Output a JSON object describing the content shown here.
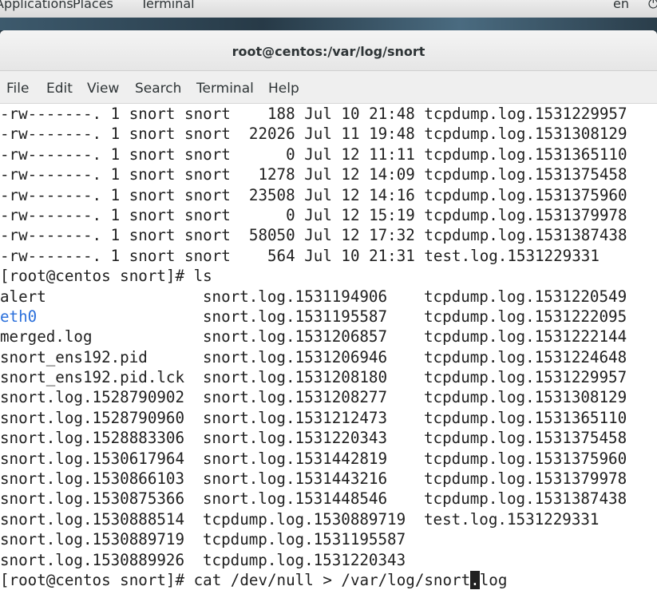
{
  "topbar": {
    "menu": [
      "Applications",
      "Places",
      "Terminal"
    ],
    "lang": "en",
    "power_icon": "power-icon"
  },
  "window": {
    "title": "root@centos:/var/log/snort"
  },
  "menubar": {
    "items": [
      "File",
      "Edit",
      "View",
      "Search",
      "Terminal",
      "Help"
    ]
  },
  "terminal": {
    "ls_long": [
      "-rw-------. 1 snort snort    188 Jul 10 21:48 tcpdump.log.1531229957",
      "-rw-------. 1 snort snort  22026 Jul 11 19:48 tcpdump.log.1531308129",
      "-rw-------. 1 snort snort      0 Jul 12 11:11 tcpdump.log.1531365110",
      "-rw-------. 1 snort snort   1278 Jul 12 14:09 tcpdump.log.1531375458",
      "-rw-------. 1 snort snort  23508 Jul 12 14:16 tcpdump.log.1531375960",
      "-rw-------. 1 snort snort      0 Jul 12 15:19 tcpdump.log.1531379978",
      "-rw-------. 1 snort snort  58050 Jul 12 17:32 tcpdump.log.1531387438",
      "-rw-------. 1 snort snort    564 Jul 10 21:31 test.log.1531229331"
    ],
    "prompt_ls": "[root@centos snort]# ls",
    "ls_rows": [
      [
        "alert",
        "snort.log.1531194906",
        "tcpdump.log.1531220549"
      ],
      [
        "eth0",
        "snort.log.1531195587",
        "tcpdump.log.1531222095"
      ],
      [
        "merged.log",
        "snort.log.1531206857",
        "tcpdump.log.1531222144"
      ],
      [
        "snort_ens192.pid",
        "snort.log.1531206946",
        "tcpdump.log.1531224648"
      ],
      [
        "snort_ens192.pid.lck",
        "snort.log.1531208180",
        "tcpdump.log.1531229957"
      ],
      [
        "snort.log.1528790902",
        "snort.log.1531208277",
        "tcpdump.log.1531308129"
      ],
      [
        "snort.log.1528790960",
        "snort.log.1531212473",
        "tcpdump.log.1531365110"
      ],
      [
        "snort.log.1528883306",
        "snort.log.1531220343",
        "tcpdump.log.1531375458"
      ],
      [
        "snort.log.1530617964",
        "snort.log.1531442819",
        "tcpdump.log.1531375960"
      ],
      [
        "snort.log.1530866103",
        "snort.log.1531443216",
        "tcpdump.log.1531379978"
      ],
      [
        "snort.log.1530875366",
        "snort.log.1531448546",
        "tcpdump.log.1531387438"
      ],
      [
        "snort.log.1530888514",
        "tcpdump.log.1530889719",
        "test.log.1531229331"
      ],
      [
        "snort.log.1530889719",
        "tcpdump.log.1531195587",
        ""
      ],
      [
        "snort.log.1530889926",
        "tcpdump.log.1531220343",
        ""
      ]
    ],
    "directory_entries": [
      "eth0"
    ],
    "final_prompt_before_cursor": "[root@centos snort]# cat /dev/null > /var/log/snort",
    "cursor_char": ".",
    "final_prompt_after_cursor": "log"
  }
}
